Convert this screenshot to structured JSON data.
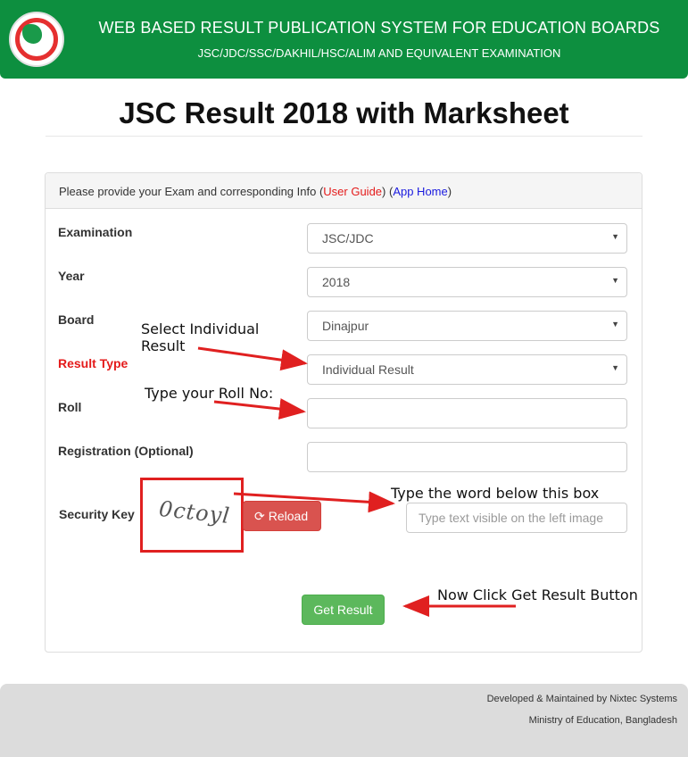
{
  "header": {
    "title": "WEB BASED RESULT PUBLICATION SYSTEM FOR EDUCATION BOARDS",
    "subtitle": "JSC/JDC/SSC/DAKHIL/HSC/ALIM AND EQUIVALENT EXAMINATION"
  },
  "page_title": "JSC Result 2018 with Marksheet",
  "panel": {
    "intro": "Please provide your Exam and corresponding Info (",
    "user_guide": "User Guide",
    "between": ") (",
    "app_home": "App Home",
    "end": ")"
  },
  "form": {
    "examination": {
      "label": "Examination",
      "value": "JSC/JDC"
    },
    "year": {
      "label": "Year",
      "value": "2018"
    },
    "board": {
      "label": "Board",
      "value": "Dinajpur"
    },
    "result_type": {
      "label": "Result Type",
      "value": "Individual Result"
    },
    "roll": {
      "label": "Roll",
      "value": ""
    },
    "registration": {
      "label": "Registration (Optional)",
      "value": ""
    },
    "security_key": {
      "label": "Security Key",
      "captcha": "0ctoyl",
      "reload_label": "Reload",
      "placeholder": "Type text visible on the left image"
    },
    "submit_label": "Get Result"
  },
  "annotations": {
    "select_individual_1": "Select Individual",
    "select_individual_2": "Result",
    "type_roll": "Type your Roll No:",
    "type_word": "Type the word below this box",
    "click_get": "Now Click Get Result Button"
  },
  "footer": {
    "developer": "Developed & Maintained by Nixtec Systems",
    "ministry": "Ministry of Education, Bangladesh"
  },
  "colors": {
    "header_green": "#0d8f3f",
    "label_red": "#e41b1b",
    "link_blue": "#1a1adf",
    "reload_red": "#d9534f",
    "submit_green": "#5cb85c",
    "annotation_red": "#e02020"
  },
  "icons": [
    "bangladesh-seal-logo",
    "reload-icon",
    "chevron-down-icon"
  ]
}
